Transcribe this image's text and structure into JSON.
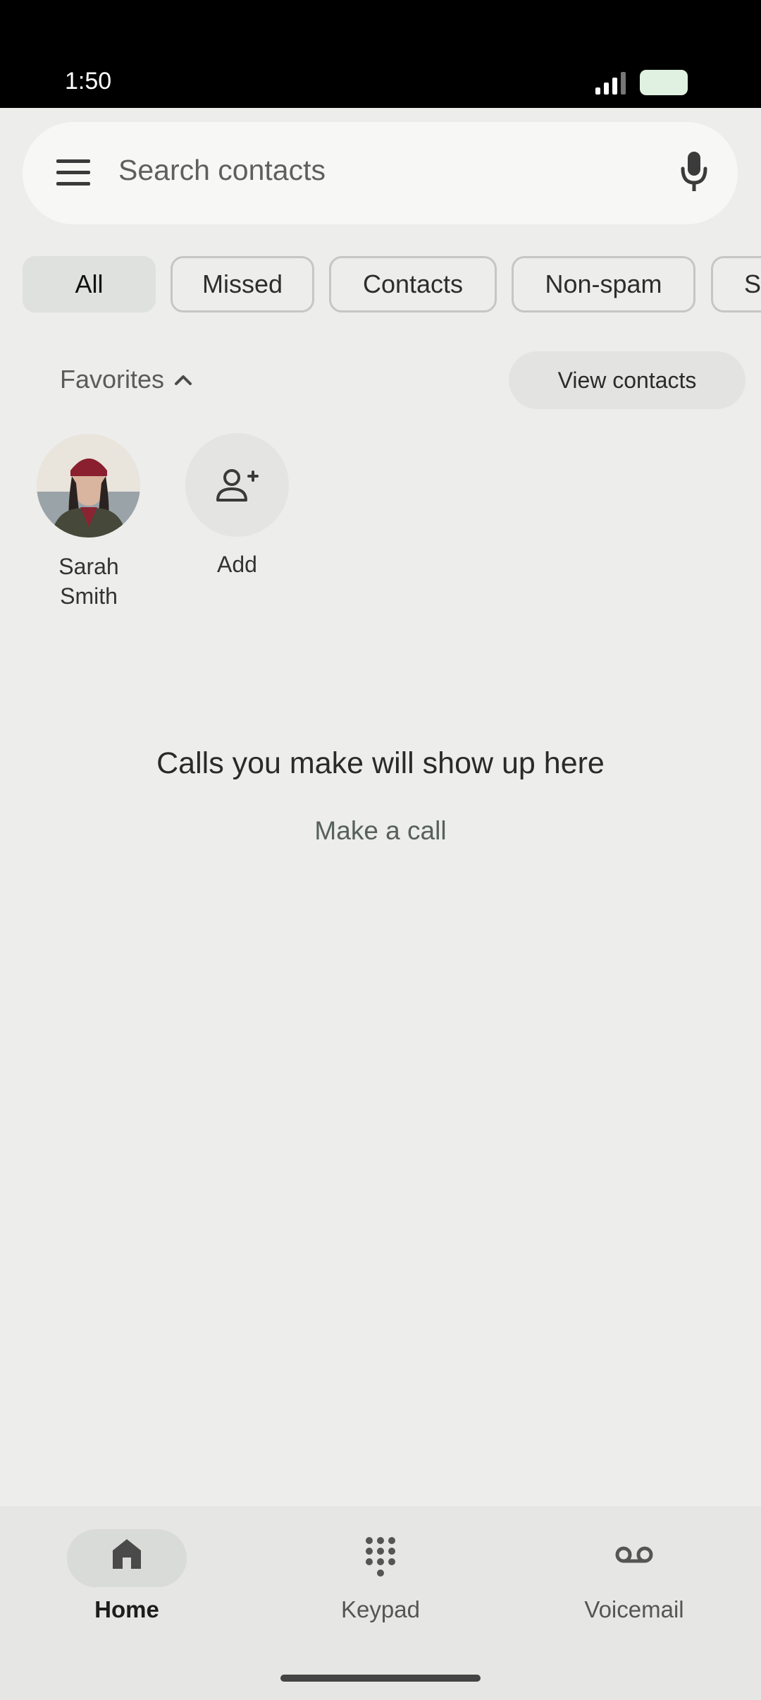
{
  "status_bar": {
    "time": "1:50"
  },
  "search": {
    "placeholder": "Search contacts",
    "menu_icon": "menu-icon",
    "mic_icon": "mic-icon"
  },
  "filters": [
    {
      "label": "All",
      "active": true
    },
    {
      "label": "Missed",
      "active": false
    },
    {
      "label": "Contacts",
      "active": false
    },
    {
      "label": "Non-spam",
      "active": false
    },
    {
      "label": "Sp",
      "active": false
    }
  ],
  "favorites": {
    "title": "Favorites",
    "view_contacts_label": "View contacts",
    "contacts": [
      {
        "name": "Sarah Smith"
      }
    ],
    "add_label": "Add"
  },
  "empty_state": {
    "title": "Calls you make will show up here",
    "action": "Make a call"
  },
  "bottom_nav": [
    {
      "label": "Home",
      "icon": "home-icon",
      "active": true
    },
    {
      "label": "Keypad",
      "icon": "dialpad-icon",
      "active": false
    },
    {
      "label": "Voicemail",
      "icon": "voicemail-icon",
      "active": false
    }
  ],
  "colors": {
    "background": "#ededeb",
    "active_chip": "#dfe1df",
    "nav_bar": "#e6e6e4"
  }
}
